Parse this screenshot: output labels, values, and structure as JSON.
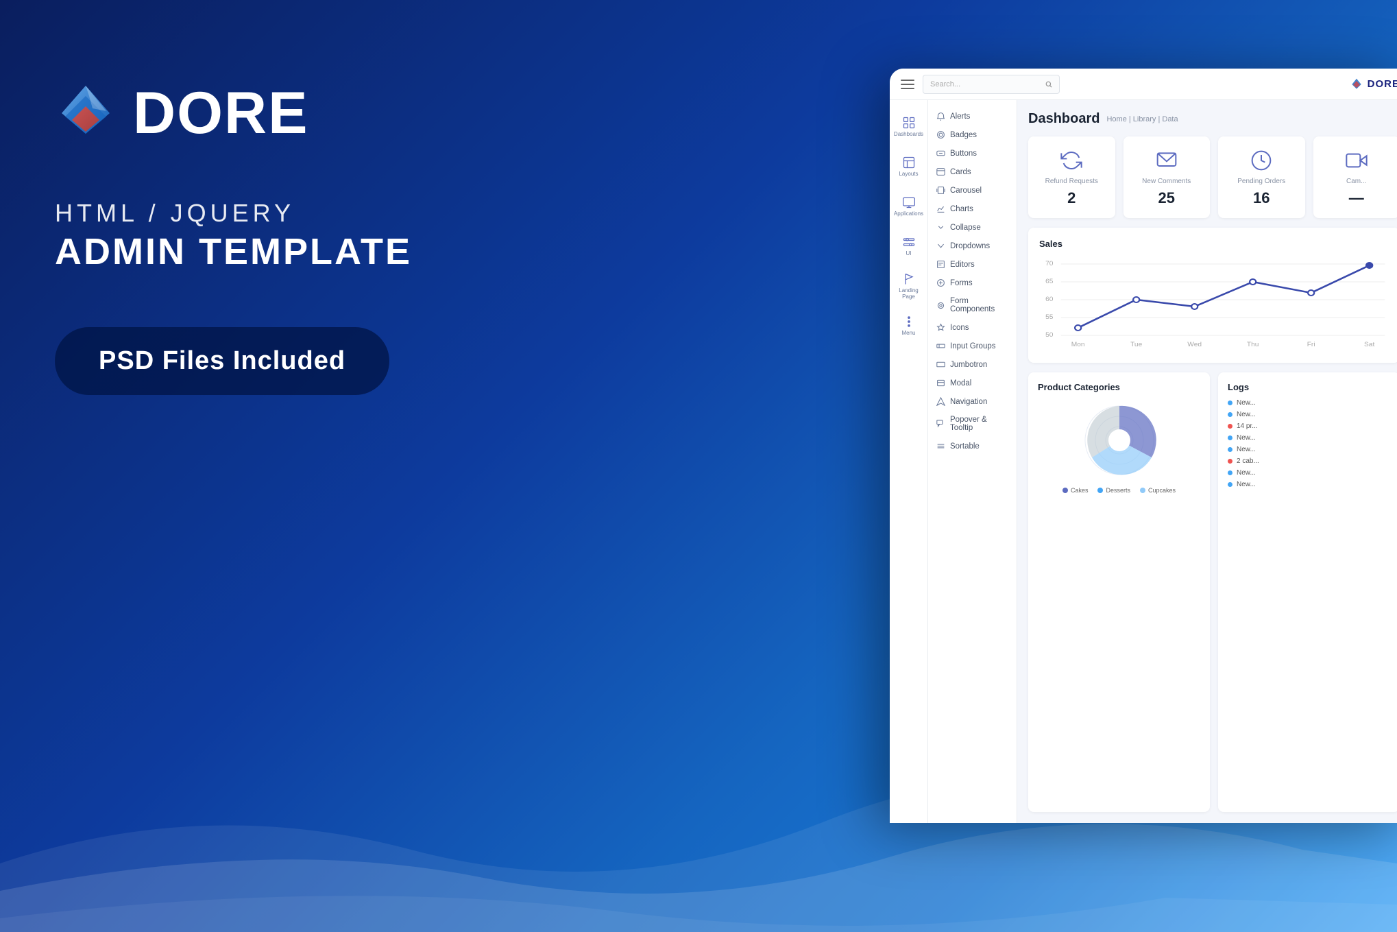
{
  "background": {
    "gradient_start": "#0a1e5e",
    "gradient_end": "#42a5f5"
  },
  "brand": {
    "name": "DORE",
    "tagline_top": "HTML / JQUERY",
    "tagline_main": "ADMIN TEMPLATE",
    "badge": "PSD Files Included"
  },
  "topbar": {
    "search_placeholder": "Search...",
    "logo_text": "DORE"
  },
  "sidebar": {
    "items": [
      {
        "label": "Dashboards",
        "icon": "grid"
      },
      {
        "label": "Layouts",
        "icon": "layout"
      },
      {
        "label": "Applications",
        "icon": "monitor"
      },
      {
        "label": "UI",
        "icon": "sliders"
      },
      {
        "label": "Landing Page",
        "icon": "flag"
      },
      {
        "label": "Menu",
        "icon": "menu"
      }
    ]
  },
  "nav_items": [
    {
      "label": "Alerts"
    },
    {
      "label": "Badges"
    },
    {
      "label": "Buttons"
    },
    {
      "label": "Cards"
    },
    {
      "label": "Carousel"
    },
    {
      "label": "Charts"
    },
    {
      "label": "Collapse"
    },
    {
      "label": "Dropdowns"
    },
    {
      "label": "Editors"
    },
    {
      "label": "Forms"
    },
    {
      "label": "Form Components"
    },
    {
      "label": "Icons"
    },
    {
      "label": "Input Groups"
    },
    {
      "label": "Jumbotron"
    },
    {
      "label": "Modal"
    },
    {
      "label": "Navigation"
    },
    {
      "label": "Popover & Tooltip"
    },
    {
      "label": "Sortable"
    }
  ],
  "dashboard": {
    "title": "Dashboard",
    "breadcrumb": "Home  |  Library  |  Data",
    "stats": [
      {
        "label": "Refund Requests",
        "value": "2",
        "icon": "refresh"
      },
      {
        "label": "New Comments",
        "value": "25",
        "icon": "mail"
      },
      {
        "label": "Pending Orders",
        "value": "16",
        "icon": "clock"
      },
      {
        "label": "Cam...",
        "value": "—",
        "icon": "camera"
      }
    ],
    "chart": {
      "title": "Sales",
      "y_axis": [
        70,
        65,
        60,
        55,
        50
      ],
      "x_labels": [
        "Mon",
        "Tue",
        "Wed",
        "Thu",
        "Fri",
        "Sat"
      ],
      "data_points": [
        52,
        60,
        58,
        65,
        62,
        70
      ]
    },
    "product_categories": {
      "title": "Product Categories",
      "legend": [
        {
          "label": "Cakes",
          "color": "#5c6bc0"
        },
        {
          "label": "Desserts",
          "color": "#42a5f5"
        },
        {
          "label": "Cupcakes",
          "color": "#90caf9"
        }
      ]
    },
    "logs": {
      "title": "Logs",
      "items": [
        {
          "text": "New...",
          "color": "#42a5f5"
        },
        {
          "text": "New...",
          "color": "#42a5f5"
        },
        {
          "text": "14 pr...",
          "color": "#ef5350"
        },
        {
          "text": "New...",
          "color": "#42a5f5"
        },
        {
          "text": "New...",
          "color": "#42a5f5"
        },
        {
          "text": "2 cab...",
          "color": "#ef5350"
        },
        {
          "text": "New...",
          "color": "#42a5f5"
        },
        {
          "text": "New...",
          "color": "#42a5f5"
        }
      ]
    }
  }
}
